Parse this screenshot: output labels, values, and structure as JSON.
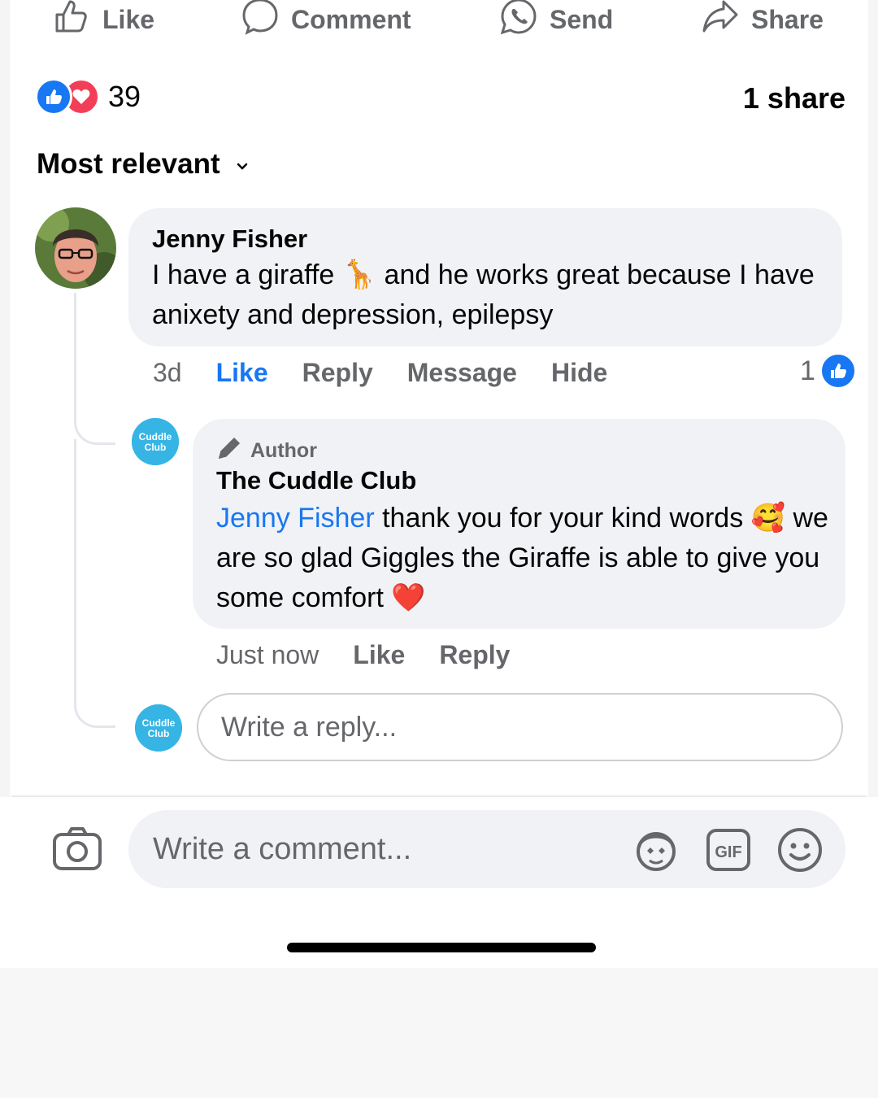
{
  "actions": [
    {
      "label": "Like",
      "icon": "thumbs-up-icon"
    },
    {
      "label": "Comment",
      "icon": "comment-icon"
    },
    {
      "label": "Send",
      "icon": "whatsapp-icon"
    },
    {
      "label": "Share",
      "icon": "share-arrow-icon"
    }
  ],
  "reactions": {
    "count": "39",
    "types": [
      "like",
      "love"
    ]
  },
  "shares": "1 share",
  "sort": {
    "label": "Most relevant"
  },
  "comment": {
    "author": "Jenny Fisher",
    "text_part1": "I have a giraffe ",
    "emoji": "🦒",
    "text_part2": " and he works great  because I have anixety and depression, epilepsy",
    "time": "3d",
    "like": "Like",
    "reply": "Reply",
    "message": "Message",
    "hide": "Hide",
    "like_count": "1"
  },
  "reply": {
    "badge": "Author",
    "author": "The Cuddle Club",
    "mention": "Jenny Fisher",
    "text_part1": " thank you for your kind words ",
    "emoji1": "🥰",
    "text_part2": " we are so glad Giggles the Giraffe is able to give you some comfort ",
    "emoji2": "❤️",
    "time": "Just now",
    "like": "Like",
    "reply": "Reply"
  },
  "reply_input": {
    "placeholder": "Write a reply..."
  },
  "comment_input": {
    "placeholder": "Write a comment..."
  },
  "avatar_text": "The Cuddle Club",
  "colors": {
    "accent": "#1877f2",
    "love": "#f33e58",
    "bubble": "#f0f2f5",
    "muted": "#65676b",
    "brand": "#36b5e5"
  }
}
